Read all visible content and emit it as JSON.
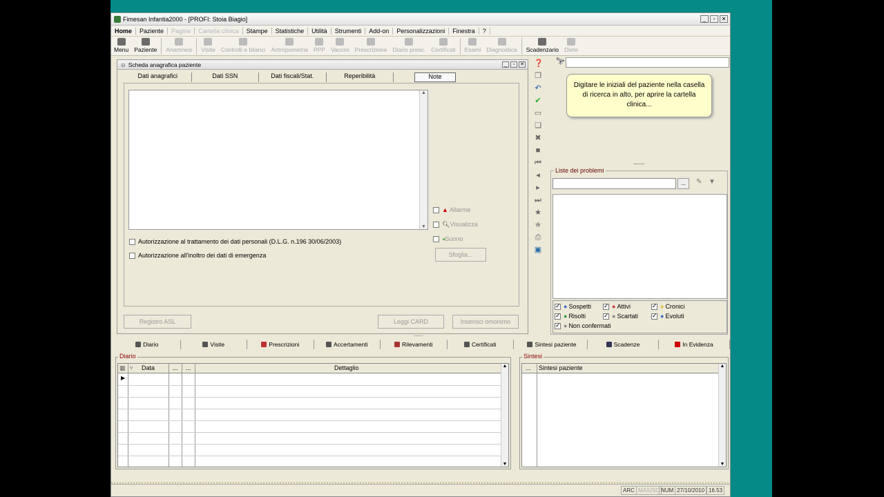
{
  "app": {
    "title": "Fimesan Infantia2000 - [PROFI: Stoia Biagio]",
    "menu": [
      {
        "label": "Home",
        "enabled": true
      },
      {
        "label": "Paziente",
        "enabled": true
      },
      {
        "label": "Pagine",
        "enabled": false
      },
      {
        "label": "Cartella clinica",
        "enabled": false
      },
      {
        "label": "Stampe",
        "enabled": true
      },
      {
        "label": "Statistiche",
        "enabled": true
      },
      {
        "label": "Utilità",
        "enabled": true
      },
      {
        "label": "Strumenti",
        "enabled": true
      },
      {
        "label": "Add-on",
        "enabled": true
      },
      {
        "label": "Personalizzazioni",
        "enabled": true
      },
      {
        "label": "Finestra",
        "enabled": true
      },
      {
        "label": "?",
        "enabled": true
      }
    ],
    "toolbar": [
      {
        "label": "Menu",
        "enabled": true
      },
      {
        "label": "Paziente",
        "enabled": true
      },
      {
        "label": "Anamnesi",
        "enabled": false
      },
      {
        "label": "Visite",
        "enabled": false
      },
      {
        "label": "Controlli e bilanci",
        "enabled": false
      },
      {
        "label": "Antropometria",
        "enabled": false
      },
      {
        "label": "PPP",
        "enabled": false
      },
      {
        "label": "Vaccini",
        "enabled": false
      },
      {
        "label": "Prescrizione",
        "enabled": false
      },
      {
        "label": "Diario presc.",
        "enabled": false
      },
      {
        "label": "Certificati",
        "enabled": false
      },
      {
        "label": "Esami",
        "enabled": false
      },
      {
        "label": "Diagnostica",
        "enabled": false
      },
      {
        "label": "Scadenzario",
        "enabled": true
      },
      {
        "label": "Diete",
        "enabled": false
      }
    ]
  },
  "scheda": {
    "title": "Scheda anagrafica paziente",
    "tabs": [
      "Dati anagrafici",
      "Dati SSN",
      "Dati fiscali/Stat.",
      "Reperibilità",
      "Note"
    ],
    "active_tab": "Note",
    "auth1": "Autorizzazione al trattamento dei dati personali (D.L.G. n.196 30/06/2003)",
    "auth2": "Autorizzazione all'inoltro dei dati di emergenza",
    "opt_allarme": "Allarme",
    "opt_visualizza": "Visualizza",
    "opt_suono": "Suono",
    "btn_sfoglia": "Sfoglia...",
    "btn_registro": "Registro ASL",
    "btn_leggi": "Leggi CARD",
    "btn_omonimo": "Inserisci omonimo"
  },
  "tooltip": "Digitare le iniziali del paziente nella casella di ricerca in alto, per aprire la cartella clinica...",
  "problemi": {
    "label": "Liste dei problemi",
    "browse": "...",
    "filters": [
      "Sospetti",
      "Attivi",
      "Cronici",
      "Risolti",
      "Scartati",
      "Evoluti",
      "Non confermati"
    ]
  },
  "bottom_tabs_left": [
    "Diario",
    "Visite",
    "Prescrizioni",
    "Accertamenti",
    "Rilevamenti",
    "Certificati"
  ],
  "bottom_tabs_right": [
    "Sintesi paziente",
    "Scadenze",
    "In Evidenza"
  ],
  "diario": {
    "group": "Diario",
    "columns": [
      "Data",
      "...",
      "...",
      "Dettaglio"
    ]
  },
  "sintesi": {
    "group": "Sintesi",
    "columns": [
      "...",
      "Sintesi paziente"
    ]
  },
  "status": {
    "arc": "ARC",
    "maiusc": "MAIUSC",
    "num": "NUM",
    "date": "27/10/2010",
    "time": "16.53"
  }
}
